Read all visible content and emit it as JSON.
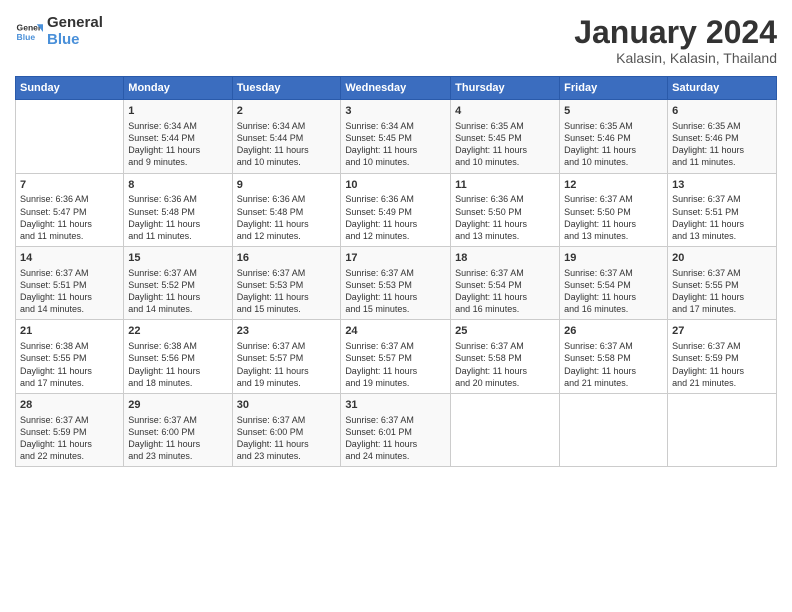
{
  "header": {
    "logo_general": "General",
    "logo_blue": "Blue",
    "month_title": "January 2024",
    "location": "Kalasin, Kalasin, Thailand"
  },
  "calendar": {
    "headers": [
      "Sunday",
      "Monday",
      "Tuesday",
      "Wednesday",
      "Thursday",
      "Friday",
      "Saturday"
    ],
    "weeks": [
      [
        {
          "day": "",
          "info": ""
        },
        {
          "day": "1",
          "info": "Sunrise: 6:34 AM\nSunset: 5:44 PM\nDaylight: 11 hours\nand 9 minutes."
        },
        {
          "day": "2",
          "info": "Sunrise: 6:34 AM\nSunset: 5:44 PM\nDaylight: 11 hours\nand 10 minutes."
        },
        {
          "day": "3",
          "info": "Sunrise: 6:34 AM\nSunset: 5:45 PM\nDaylight: 11 hours\nand 10 minutes."
        },
        {
          "day": "4",
          "info": "Sunrise: 6:35 AM\nSunset: 5:45 PM\nDaylight: 11 hours\nand 10 minutes."
        },
        {
          "day": "5",
          "info": "Sunrise: 6:35 AM\nSunset: 5:46 PM\nDaylight: 11 hours\nand 10 minutes."
        },
        {
          "day": "6",
          "info": "Sunrise: 6:35 AM\nSunset: 5:46 PM\nDaylight: 11 hours\nand 11 minutes."
        }
      ],
      [
        {
          "day": "7",
          "info": "Sunrise: 6:36 AM\nSunset: 5:47 PM\nDaylight: 11 hours\nand 11 minutes."
        },
        {
          "day": "8",
          "info": "Sunrise: 6:36 AM\nSunset: 5:48 PM\nDaylight: 11 hours\nand 11 minutes."
        },
        {
          "day": "9",
          "info": "Sunrise: 6:36 AM\nSunset: 5:48 PM\nDaylight: 11 hours\nand 12 minutes."
        },
        {
          "day": "10",
          "info": "Sunrise: 6:36 AM\nSunset: 5:49 PM\nDaylight: 11 hours\nand 12 minutes."
        },
        {
          "day": "11",
          "info": "Sunrise: 6:36 AM\nSunset: 5:50 PM\nDaylight: 11 hours\nand 13 minutes."
        },
        {
          "day": "12",
          "info": "Sunrise: 6:37 AM\nSunset: 5:50 PM\nDaylight: 11 hours\nand 13 minutes."
        },
        {
          "day": "13",
          "info": "Sunrise: 6:37 AM\nSunset: 5:51 PM\nDaylight: 11 hours\nand 13 minutes."
        }
      ],
      [
        {
          "day": "14",
          "info": "Sunrise: 6:37 AM\nSunset: 5:51 PM\nDaylight: 11 hours\nand 14 minutes."
        },
        {
          "day": "15",
          "info": "Sunrise: 6:37 AM\nSunset: 5:52 PM\nDaylight: 11 hours\nand 14 minutes."
        },
        {
          "day": "16",
          "info": "Sunrise: 6:37 AM\nSunset: 5:53 PM\nDaylight: 11 hours\nand 15 minutes."
        },
        {
          "day": "17",
          "info": "Sunrise: 6:37 AM\nSunset: 5:53 PM\nDaylight: 11 hours\nand 15 minutes."
        },
        {
          "day": "18",
          "info": "Sunrise: 6:37 AM\nSunset: 5:54 PM\nDaylight: 11 hours\nand 16 minutes."
        },
        {
          "day": "19",
          "info": "Sunrise: 6:37 AM\nSunset: 5:54 PM\nDaylight: 11 hours\nand 16 minutes."
        },
        {
          "day": "20",
          "info": "Sunrise: 6:37 AM\nSunset: 5:55 PM\nDaylight: 11 hours\nand 17 minutes."
        }
      ],
      [
        {
          "day": "21",
          "info": "Sunrise: 6:38 AM\nSunset: 5:55 PM\nDaylight: 11 hours\nand 17 minutes."
        },
        {
          "day": "22",
          "info": "Sunrise: 6:38 AM\nSunset: 5:56 PM\nDaylight: 11 hours\nand 18 minutes."
        },
        {
          "day": "23",
          "info": "Sunrise: 6:37 AM\nSunset: 5:57 PM\nDaylight: 11 hours\nand 19 minutes."
        },
        {
          "day": "24",
          "info": "Sunrise: 6:37 AM\nSunset: 5:57 PM\nDaylight: 11 hours\nand 19 minutes."
        },
        {
          "day": "25",
          "info": "Sunrise: 6:37 AM\nSunset: 5:58 PM\nDaylight: 11 hours\nand 20 minutes."
        },
        {
          "day": "26",
          "info": "Sunrise: 6:37 AM\nSunset: 5:58 PM\nDaylight: 11 hours\nand 21 minutes."
        },
        {
          "day": "27",
          "info": "Sunrise: 6:37 AM\nSunset: 5:59 PM\nDaylight: 11 hours\nand 21 minutes."
        }
      ],
      [
        {
          "day": "28",
          "info": "Sunrise: 6:37 AM\nSunset: 5:59 PM\nDaylight: 11 hours\nand 22 minutes."
        },
        {
          "day": "29",
          "info": "Sunrise: 6:37 AM\nSunset: 6:00 PM\nDaylight: 11 hours\nand 23 minutes."
        },
        {
          "day": "30",
          "info": "Sunrise: 6:37 AM\nSunset: 6:00 PM\nDaylight: 11 hours\nand 23 minutes."
        },
        {
          "day": "31",
          "info": "Sunrise: 6:37 AM\nSunset: 6:01 PM\nDaylight: 11 hours\nand 24 minutes."
        },
        {
          "day": "",
          "info": ""
        },
        {
          "day": "",
          "info": ""
        },
        {
          "day": "",
          "info": ""
        }
      ]
    ]
  }
}
